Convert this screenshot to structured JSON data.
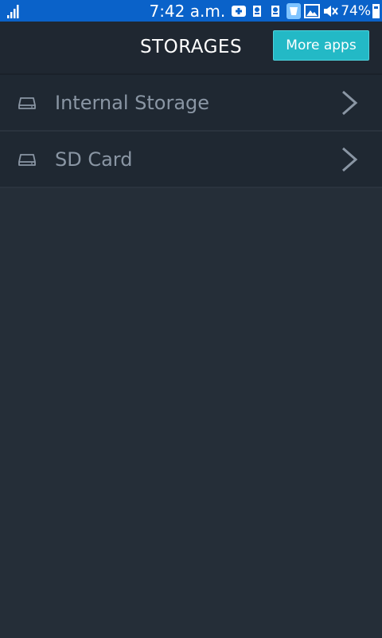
{
  "status_bar": {
    "time": "7:42 a.m.",
    "battery": "74%",
    "battery_level": 0.74,
    "icons": [
      "signal-icon",
      "message-icon",
      "app-notification-icon",
      "app-notification-icon",
      "app-notification-icon",
      "image-icon",
      "mute-icon",
      "battery-icon"
    ]
  },
  "header": {
    "title": "STORAGES",
    "more_apps_label": "More apps"
  },
  "storages": [
    {
      "label": "Internal Storage",
      "icon": "drive-icon"
    },
    {
      "label": "SD Card",
      "icon": "drive-icon"
    }
  ],
  "colors": {
    "status_bar": "#0a62c9",
    "background": "#252e38",
    "header": "#1f2731",
    "accent": "#23b9c6",
    "row_text": "#8a96a4"
  }
}
